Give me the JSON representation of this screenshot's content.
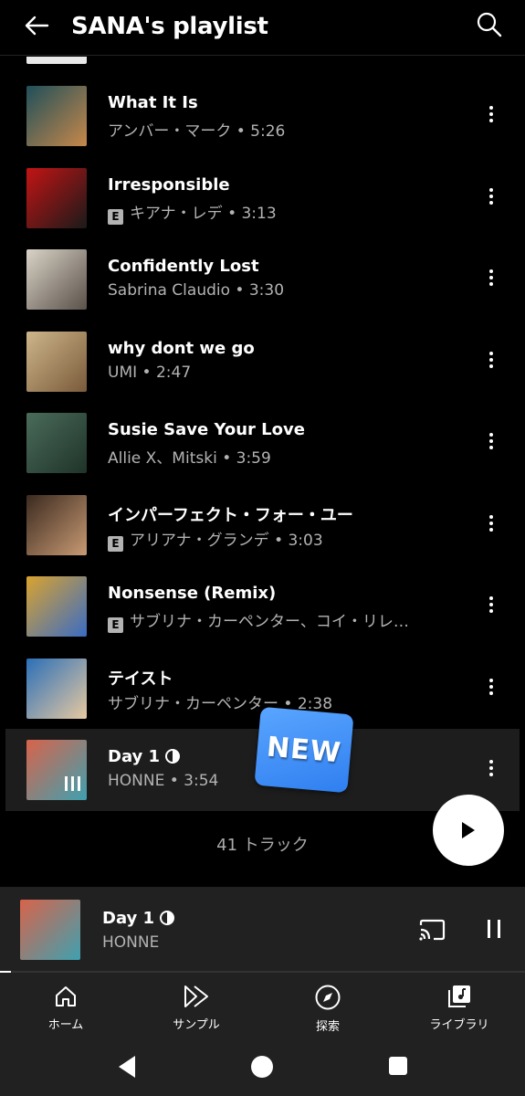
{
  "header": {
    "title": "SANA's playlist"
  },
  "tracks": [
    {
      "title": "What It Is",
      "subtitle": "アンバー・マーク • 5:26",
      "explicit": false,
      "art": [
        "#1f4f5a",
        "#c7884a"
      ]
    },
    {
      "title": "Irresponsible",
      "subtitle": "キアナ・レデ • 3:13",
      "explicit": true,
      "art": [
        "#c21414",
        "#1a1a1a"
      ]
    },
    {
      "title": "Confidently Lost",
      "subtitle": "Sabrina Claudio • 3:30",
      "explicit": false,
      "art": [
        "#d9d3c7",
        "#5a5149"
      ]
    },
    {
      "title": "why dont we go",
      "subtitle": "UMI • 2:47",
      "explicit": false,
      "art": [
        "#cdb58a",
        "#7a5a3a"
      ]
    },
    {
      "title": "Susie Save Your Love",
      "subtitle": "Allie X、Mitski • 3:59",
      "explicit": false,
      "art": [
        "#4a6b5a",
        "#1f3329"
      ]
    },
    {
      "title": "インパーフェクト・フォー・ユー",
      "subtitle": "アリアナ・グランデ • 3:03",
      "explicit": true,
      "art": [
        "#3b2a1f",
        "#c89a74"
      ]
    },
    {
      "title": "Nonsense (Remix)",
      "subtitle": "サブリナ・カーペンター、コイ・リレ…",
      "explicit": true,
      "art": [
        "#d9a32f",
        "#3a6cc4"
      ]
    },
    {
      "title": "テイスト",
      "subtitle": "サブリナ・カーペンター • 2:38",
      "explicit": false,
      "art": [
        "#2b6fb8",
        "#e7c9a1"
      ]
    },
    {
      "title": "Day 1",
      "subtitle": "HONNE • 3:54",
      "explicit": false,
      "current": true,
      "art": [
        "#d8634a",
        "#3ea1b0"
      ]
    }
  ],
  "badge": {
    "text": "NEW"
  },
  "track_count": "41 トラック",
  "mini_player": {
    "title": "Day 1",
    "artist": "HONNE",
    "progress": 0.02
  },
  "nav": {
    "items": [
      {
        "label": "ホーム",
        "icon": "home-icon"
      },
      {
        "label": "サンプル",
        "icon": "samples-icon"
      },
      {
        "label": "探索",
        "icon": "explore-icon"
      },
      {
        "label": "ライブラリ",
        "icon": "library-icon"
      }
    ]
  },
  "colors": {
    "background": "#000000",
    "panel": "#212121",
    "subtext": "#b3b3b3",
    "badge": "#2f7ff0"
  }
}
